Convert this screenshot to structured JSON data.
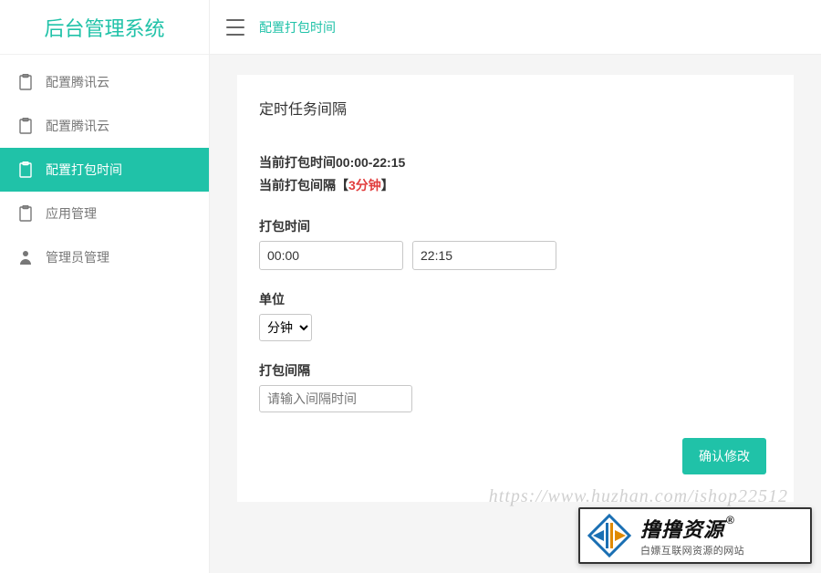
{
  "logo": "后台管理系统",
  "breadcrumb": "配置打包时间",
  "sidebar": {
    "items": [
      {
        "label": "配置腾讯云",
        "icon": "clipboard-icon"
      },
      {
        "label": "配置腾讯云",
        "icon": "clipboard-icon"
      },
      {
        "label": "配置打包时间",
        "icon": "clipboard-icon"
      },
      {
        "label": "应用管理",
        "icon": "clipboard-icon"
      },
      {
        "label": "管理员管理",
        "icon": "user-icon"
      }
    ],
    "activeIndex": 2
  },
  "card": {
    "title": "定时任务间隔",
    "currentTimeLabel": "当前打包时间",
    "currentTimeValue": "00:00-22:15",
    "currentIntervalLabel": "当前打包间隔",
    "bracketOpen": "【",
    "currentIntervalValue": "3分钟",
    "bracketClose": "】",
    "form": {
      "timeLabel": "打包时间",
      "timeStart": "00:00",
      "timeEnd": "22:15",
      "unitLabel": "单位",
      "unitSelected": "分钟",
      "intervalLabel": "打包间隔",
      "intervalPlaceholder": "请输入间隔时间",
      "submit": "确认修改"
    }
  },
  "watermark": "https://www.huzhan.com/ishop22512",
  "brand": {
    "name": "撸撸资源",
    "reg": "®",
    "tagline": "白嫖互联网资源的网站"
  }
}
